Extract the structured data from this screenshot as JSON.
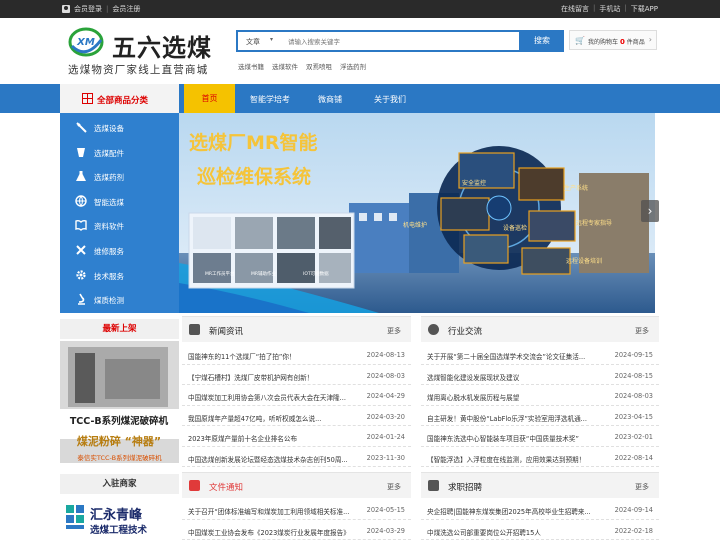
{
  "topbar": {
    "login": "会员登录",
    "register": "会员注册",
    "right": [
      "在线留言",
      "手机站",
      "下载APP"
    ]
  },
  "header": {
    "logo_mark": "XM",
    "logo_text": "五六选煤",
    "slogan": "选煤物资厂家线上直营商城",
    "search": {
      "category": "文章",
      "placeholder": "请输入搜索关键字",
      "button": "搜索"
    },
    "hotwords": [
      "选煤书籍",
      "选煤软件",
      "双焉喷咀",
      "浮选药剂"
    ],
    "cart": {
      "prefix": "我的购物车",
      "count": "0",
      "suffix": "件商品"
    }
  },
  "nav": {
    "categories_title": "全部商品分类",
    "links": [
      "首页",
      "智能学培考",
      "微商铺",
      "关于我们"
    ]
  },
  "categories": [
    {
      "label": "选煤设备",
      "icon": "drill-icon"
    },
    {
      "label": "选煤配件",
      "icon": "cup-icon"
    },
    {
      "label": "选煤药剂",
      "icon": "flask-icon"
    },
    {
      "label": "智能选煤",
      "icon": "globe-icon"
    },
    {
      "label": "资料软件",
      "icon": "book-icon"
    },
    {
      "label": "维修服务",
      "icon": "tools-icon"
    },
    {
      "label": "技术服务",
      "icon": "gear-icon"
    },
    {
      "label": "煤质检测",
      "icon": "microscope-icon"
    }
  ],
  "banner": {
    "headline1": "选煤厂MR智能",
    "headline2": "巡检维保系统",
    "tags": [
      "安全监控",
      "生产系统",
      "机电维护",
      "设备巡检",
      "远程专家指导",
      "远程设备培训"
    ],
    "thumb_labels": [
      "MR工作员平台",
      "MR辅助作业",
      "IOT可视数据"
    ]
  },
  "latest": {
    "title": "最新上架",
    "image_text1": "TCC-B系列煤泥破碎机",
    "image_text2": "煤泥粉碎 “神器”",
    "caption": "泰信实TCC-B系列煤泥破碎机"
  },
  "join": {
    "title": "入驻商家",
    "logo_line1": "汇永青峰",
    "logo_line2": "选煤工程技术"
  },
  "panels": {
    "news": {
      "title": "新闻资讯",
      "more": "更多",
      "rows": [
        {
          "title": "国能神东的11个选煤厂“拍了拍”你！",
          "date": "2024-08-13"
        },
        {
          "title": "【宁煤石槽村】洗煤厂皮带机护网有创新！",
          "date": "2024-08-03"
        },
        {
          "title": "中国煤炭加工利用协会第八次会员代表大会在天津隆...",
          "date": "2024-04-29"
        },
        {
          "title": "我国原煤年产量超47亿吨，听听权威怎么说...",
          "date": "2024-03-20"
        },
        {
          "title": "2023年原煤产量前十名企业排名公布",
          "date": "2024-01-24"
        },
        {
          "title": "中国选煤创新发展论坛暨经态选煤技术杂志创刊50周...",
          "date": "2023-11-30"
        }
      ]
    },
    "exchange": {
      "title": "行业交流",
      "more": "更多",
      "rows": [
        {
          "title": "关于开展“第二十届全国选煤学术交流会”论文征集活...",
          "date": "2024-09-15"
        },
        {
          "title": "选煤智能化建设发展现状及建议",
          "date": "2024-08-15"
        },
        {
          "title": "煤用离心脱水机发展历程与展望",
          "date": "2024-08-03"
        },
        {
          "title": "自主研发！黄中股份“LabFlo乐浮”实验室用浮选机通...",
          "date": "2023-04-15"
        },
        {
          "title": "国能神东洗选中心智能装车项目获“中国质量技术奖”",
          "date": "2023-02-01"
        },
        {
          "title": "【智能浮选】入浮粒度在线监测，应用效果达到预期！",
          "date": "2022-08-14"
        }
      ]
    },
    "docs": {
      "title": "文件通知",
      "more": "更多",
      "rows": [
        {
          "title": "关于召开“团体标准编写和煤炭加工利用领域相关标准...",
          "date": "2024-05-15"
        },
        {
          "title": "中国煤炭工业协会发布《2023煤炭行业发展年度报告》",
          "date": "2024-03-29"
        }
      ]
    },
    "jobs": {
      "title": "求职招聘",
      "more": "更多",
      "rows": [
        {
          "title": "央企招聘|国能神东煤炭集团2025年高校毕业生招聘来...",
          "date": "2024-09-14"
        },
        {
          "title": "中煤洗选公司部重要岗位公开招聘15人",
          "date": "2022-02-18"
        }
      ]
    }
  },
  "colors": {
    "brand_blue": "#2b78c4",
    "accent_yellow": "#f5c200",
    "accent_red": "#dd0000"
  }
}
